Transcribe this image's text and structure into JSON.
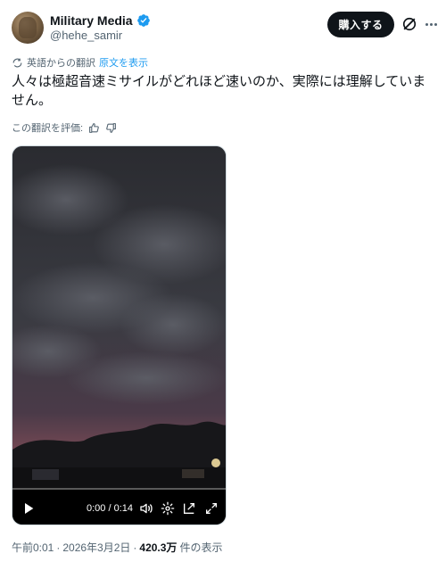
{
  "author": {
    "display_name": "Military Media",
    "handle": "@hehe_samir",
    "verified": true
  },
  "header": {
    "buy_label": "購入する"
  },
  "translation": {
    "translated_from": "英語からの翻訳",
    "show_original": "原文を表示",
    "rate_prompt": "この翻訳を評価:"
  },
  "tweet": {
    "text": "人々は極超音速ミサイルがどれほど速いのか、実際には理解していません。"
  },
  "video": {
    "time": "0:00 / 0:14",
    "progress": 0
  },
  "meta": {
    "time": "午前0:01",
    "sep1": "·",
    "date": "2026年3月2日",
    "sep2": "·",
    "views": "420.3万",
    "views_suffix": "件の表示"
  },
  "colors": {
    "accent": "#1d9bf0",
    "text": "#0f1419",
    "muted": "#536471",
    "button_bg": "#0f1419"
  },
  "icons": [
    "verified-badge-icon",
    "grok-icon",
    "more-icon",
    "translate-icon",
    "thumbs-up-icon",
    "thumbs-down-icon",
    "play-icon",
    "volume-icon",
    "settings-icon",
    "pop-out-icon",
    "fullscreen-icon"
  ]
}
